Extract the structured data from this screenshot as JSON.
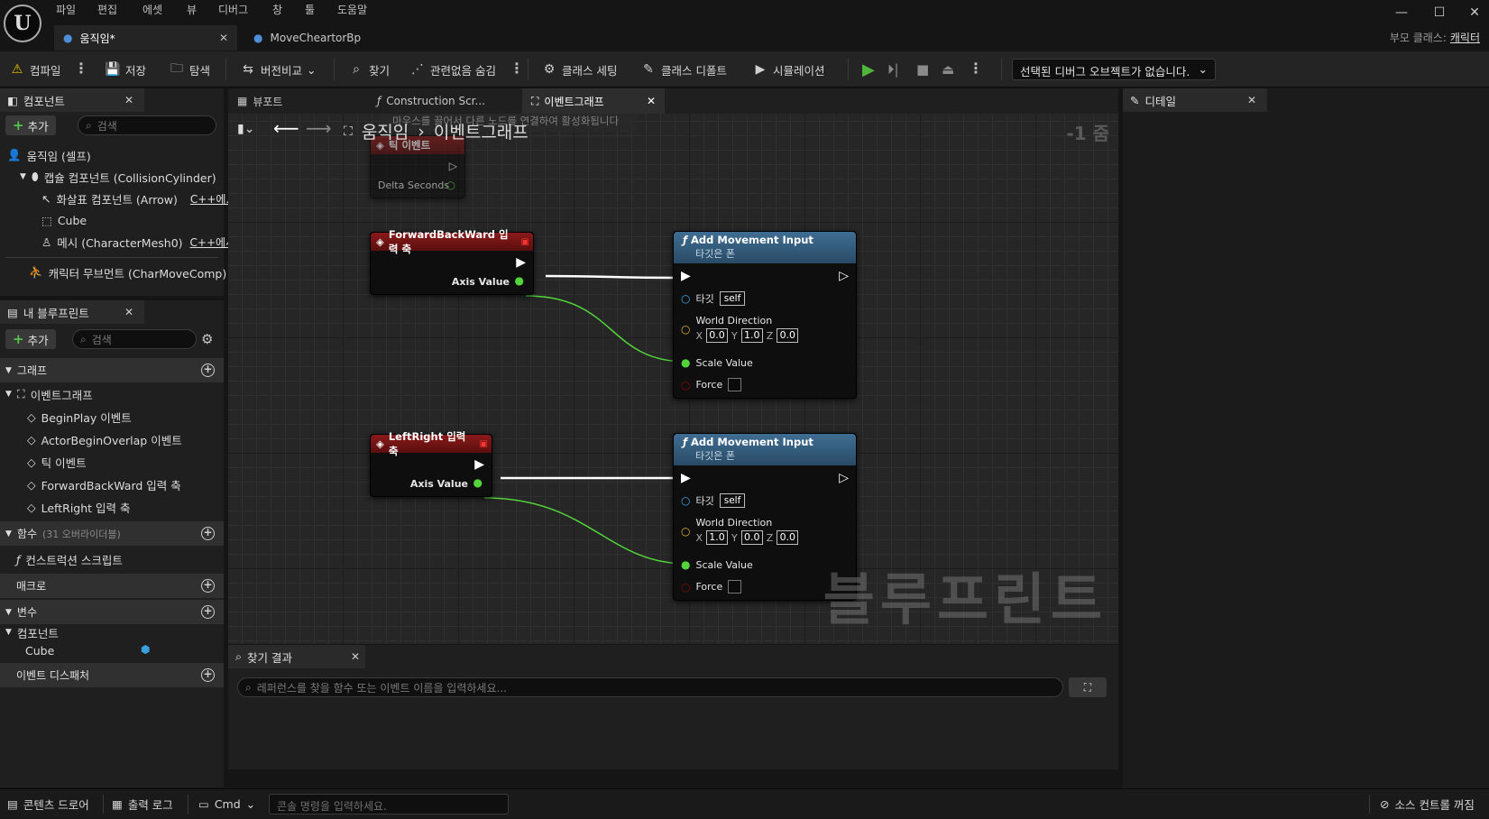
{
  "menu": [
    "파일",
    "편집",
    "에셋",
    "뷰",
    "디버그",
    "창",
    "툴",
    "도움말"
  ],
  "doc_tabs": [
    {
      "label": "움직임*"
    },
    {
      "label": "MoveCheartorBp"
    }
  ],
  "parent_class": {
    "label": "부모 클래스:",
    "value": "캐릭터"
  },
  "toolbar": {
    "compile": "컴파일",
    "save": "저장",
    "browse": "탐색",
    "diff": "버전비교",
    "find": "찾기",
    "hide_unrelated": "관련없음 숨김",
    "class_settings": "클래스 세팅",
    "class_defaults": "클래스 디폴트",
    "simulation": "시뮬레이션",
    "debug_object": "선택된 디버그 오브젝트가 없습니다."
  },
  "components_panel": {
    "title": "컴포넌트",
    "add": "추가",
    "search_placeholder": "검색",
    "tree": [
      {
        "label": "움직임 (셀프)"
      },
      {
        "label": "캡슐 컴포넌트 (CollisionCylinder)"
      },
      {
        "label": "화살표 컴포넌트 (Arrow)",
        "tag": "C++에..."
      },
      {
        "label": "Cube"
      },
      {
        "label": "메시 (CharacterMesh0)",
        "tag": "C++에서..."
      },
      {
        "label": "캐릭터 무브먼트 (CharMoveComp)"
      }
    ]
  },
  "my_blueprint": {
    "title": "내 블루프린트",
    "add": "추가",
    "search_placeholder": "검색",
    "graph_section": "그래프",
    "event_graph": "이벤트그래프",
    "events": [
      "BeginPlay 이벤트",
      "ActorBeginOverlap 이벤트",
      "틱 이벤트",
      "ForwardBackWard 입력 축",
      "LeftRight 입력 축"
    ],
    "functions_section": "함수",
    "functions_overridable": "(31 오버라이더블)",
    "construction_script": "컨스트럭션 스크립트",
    "macros_section": "매크로",
    "variables_section": "변수",
    "components_category": "컴포넌트",
    "cube_variable": "Cube",
    "event_dispatchers": "이벤트 디스패처"
  },
  "graph_tabs": [
    {
      "label": "뷰포트"
    },
    {
      "label": "Construction Scr..."
    },
    {
      "label": "이벤트그래프"
    }
  ],
  "breadcrumb": {
    "root": "움직임",
    "current": "이벤트그래프"
  },
  "zoom": "-1 줌",
  "hint_text": "마우스를 끌어서 다른 노드를 연결하여 활성화됩니다",
  "nodes": {
    "tick": {
      "title": "틱 이벤트",
      "pin": "Delta Seconds"
    },
    "forward": {
      "title": "ForwardBackWard 입력 축",
      "pin": "Axis Value"
    },
    "leftright": {
      "title": "LeftRight 입력 축",
      "pin": "Axis Value"
    },
    "add_input_1": {
      "title": "Add Movement Input",
      "subtitle": "타깃은 폰",
      "target": "타깃",
      "self": "self",
      "world_direction": "World Direction",
      "x": "0.0",
      "y": "1.0",
      "z": "0.0",
      "scale": "Scale Value",
      "force": "Force"
    },
    "add_input_2": {
      "title": "Add Movement Input",
      "subtitle": "타깃은 폰",
      "target": "타깃",
      "self": "self",
      "world_direction": "World Direction",
      "x": "1.0",
      "y": "0.0",
      "z": "0.0",
      "scale": "Scale Value",
      "force": "Force"
    }
  },
  "watermark": "블루프린트",
  "find_results": {
    "title": "찾기 결과",
    "placeholder": "레퍼런스를 찾을 함수 또는 이벤트 이름을 입력하세요..."
  },
  "details": {
    "title": "디테일"
  },
  "statusbar": {
    "content_drawer": "콘텐츠 드로어",
    "output_log": "출력 로그",
    "cmd": "Cmd",
    "console_placeholder": "콘솔 명령을 입력하세요.",
    "source_control": "소스 컨트롤 꺼짐"
  },
  "colors": {
    "event_red": "#8a1a1a",
    "function_blue": "#3f6d92",
    "float_pin": "#52d43a",
    "exec": "#ffffff",
    "play_green": "#4fb83c"
  }
}
